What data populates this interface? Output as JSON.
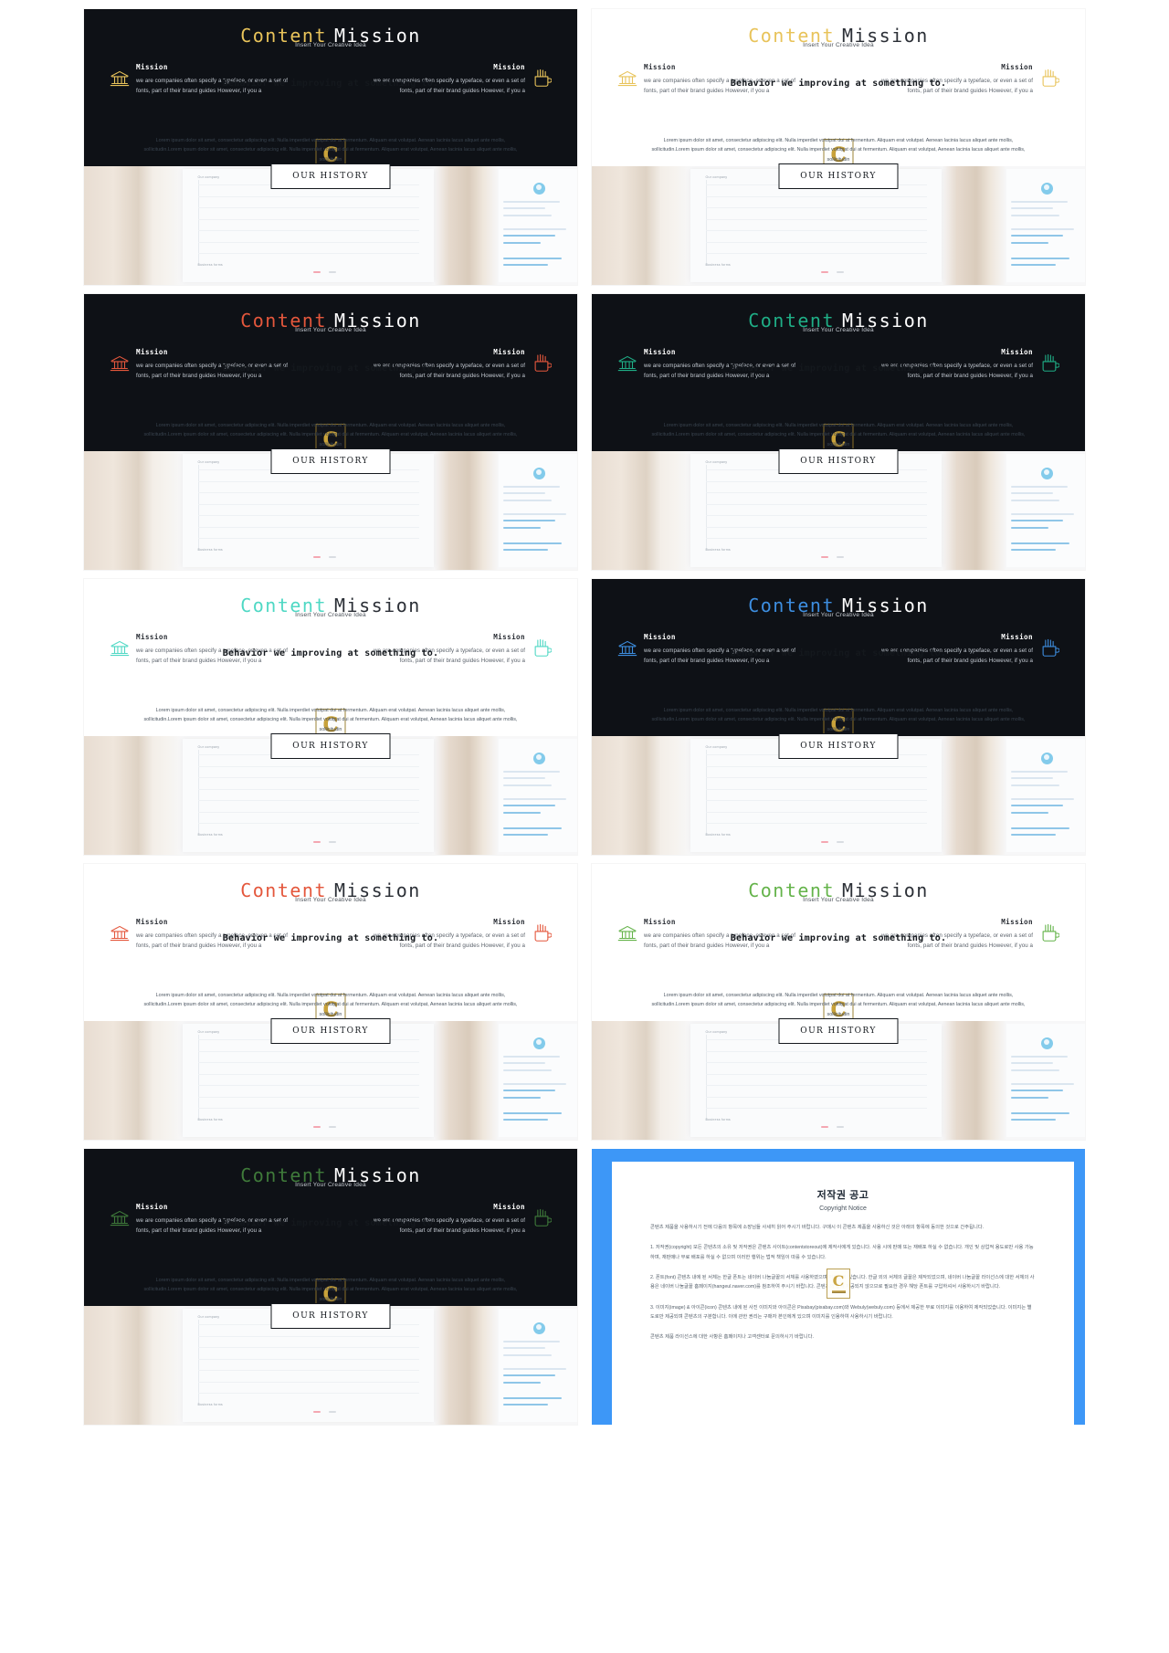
{
  "deck": {
    "title_word1": "Content",
    "title_word2": "Mission",
    "subtitle": "Insert Your Creative Idea",
    "mission_heading": "Mission",
    "mission_body": "we are companies often specify a typeface, or even a set of fonts,  part of their brand guides However, if you a",
    "history_label": "OUR HISTORY",
    "logo_letter": "C",
    "overlay_headline": "Behavior we improving at something to.",
    "overlay_body": "Lorem ipsum dolor sit amet, consectetur adipiscing elit. Nulla imperdiet volutpat dui at fermentum. Aliquam erat volutpat. Aenean lacinia lacus aliquet ante mollis, sollicitudin.Lorem ipsum dolor sit amet, consectetur adipiscing elit. Nulla imperdiet volutpat dui at fermentum. Aliquam erat volutpat, Aenean lacinia lacus aliquet ante mollis, sollicitudin",
    "sheet_label_topleft": "Our company",
    "sheet_label_bottomleft": "Business forms",
    "left_icon": "bank-pillars-icon",
    "right_icon": "cup-with-brushes-icon"
  },
  "slides": [
    {
      "id": 1,
      "accent": "#e8c35a",
      "band": "dark",
      "title_color": "#ffffff",
      "sub_color": "#c6cbd2",
      "head_color": "#ffffff",
      "body_color": "#c3c9d1"
    },
    {
      "id": 2,
      "accent": "#e8c35a",
      "band": "light",
      "title_color": "#2b2f36",
      "sub_color": "#4a5058",
      "head_color": "#2b2f36",
      "body_color": "#5c636c"
    },
    {
      "id": 3,
      "accent": "#e4573c",
      "band": "dark",
      "title_color": "#ffffff",
      "sub_color": "#c6cbd2",
      "head_color": "#ffffff",
      "body_color": "#c3c9d1"
    },
    {
      "id": 4,
      "accent": "#1fae86",
      "band": "dark",
      "title_color": "#ffffff",
      "sub_color": "#c6cbd2",
      "head_color": "#ffffff",
      "body_color": "#c3c9d1"
    },
    {
      "id": 5,
      "accent": "#4fd8c4",
      "band": "light",
      "title_color": "#2b2f36",
      "sub_color": "#4a5058",
      "head_color": "#2b2f36",
      "body_color": "#5c636c"
    },
    {
      "id": 6,
      "accent": "#3d8ee0",
      "band": "dark",
      "title_color": "#ffffff",
      "sub_color": "#c6cbd2",
      "head_color": "#ffffff",
      "body_color": "#c3c9d1"
    },
    {
      "id": 7,
      "accent": "#e4573c",
      "band": "light",
      "title_color": "#2b2f36",
      "sub_color": "#4a5058",
      "head_color": "#2b2f36",
      "body_color": "#5c636c"
    },
    {
      "id": 8,
      "accent": "#64b34a",
      "band": "light",
      "title_color": "#2b2f36",
      "sub_color": "#4a5058",
      "head_color": "#2b2f36",
      "body_color": "#5c636c"
    },
    {
      "id": 9,
      "accent": "#3f7a3a",
      "band": "dark",
      "title_color": "#ffffff",
      "sub_color": "#c6cbd2",
      "head_color": "#ffffff",
      "body_color": "#c3c9d1"
    }
  ],
  "copyright": {
    "border_color": "#3d97f7",
    "title": "저작권 공고",
    "subtitle": "Copyright Notice",
    "intro": "콘텐츠 제품을 사용하시기 전에 다음의 항목에 소장님들 사세히 읽어 주시기 바랍니다. 구매시 이 콘텐츠 제품을 사용하신 것은 아래의 항목에 동의한 것으로 간주됩니다.",
    "items": [
      "1. 저작권(copyright) 모든 콘텐츠의 소유 및 저작권은 콘텐츠 사이트(contentstoreout)에 제작사에게 있습니다. 사용 시에 판매 또는 재배포 하실 수 없습니다. 개인 및 상업적 용도로만 사용 가능하며, 재판매나 무료 배포를 하실 수 없으며 이러한 행위는 법적 책임이 따를 수 있습니다.",
      "2. 폰트(font) 콘텐츠 내에 된 서체는 한글 폰트는 네이버 나눔글꼴의 서체를 사용하였으며 저작권이 있습니다. 한글 외의 서체의 글꼴은 제작되었으며, 네이버 나눔글꼴 라이선스에 대한 서체의 사용은 네이버 나눔글꼴 홈페이지(hangeul.naver.com)를 참조하여 주시기 바랍니다. 콘텐츠의 함께 제공되지 않으므로 필요한 경우 해당 폰트를 구입하셔서 사용하시기 바랍니다.",
      "3. 이미지(image) & 아이콘(icon) 콘텐츠 내에 된 사진 이미지와 아이콘은 Pixabay(pixabay.com)와 Webuly(webuly.com) 등에서 제공한 무료 이미지를 이용하여 제작되었습니다. 이미지는 별도로만 제공되며 콘텐츠의 구분합니다. 이에 관한 권리는 구매자 본인에게 있으며 이미지를 인용하여 사용하시기 바랍니다.",
      "콘텐츠 제품 라이선스에 대한 사항은 홈페이지나 고객센터로 문의하시기 바랍니다."
    ]
  }
}
